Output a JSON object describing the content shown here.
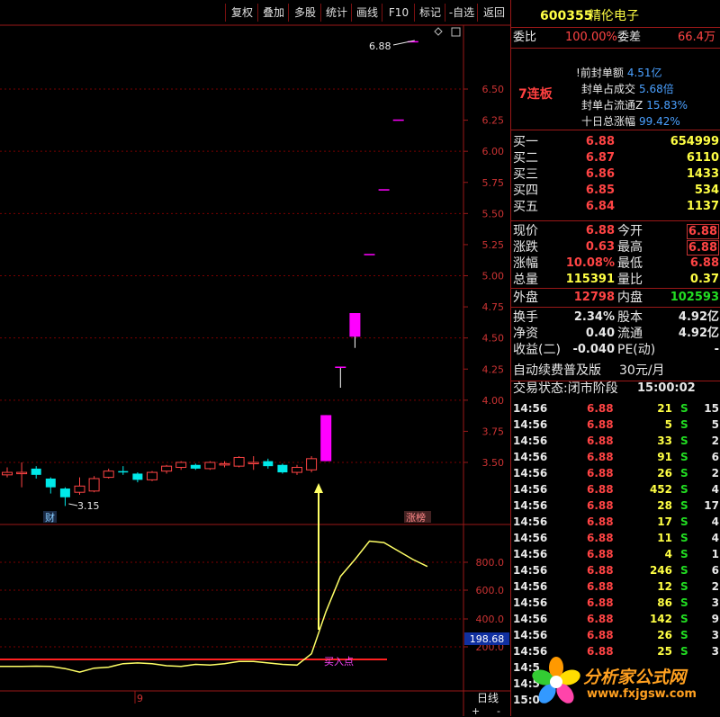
{
  "toolbar": {
    "buttons": [
      "复权",
      "叠加",
      "多股",
      "统计",
      "画线",
      "F10",
      "标记",
      "-自选",
      "返回"
    ]
  },
  "chart_data": {
    "type": "candlestick",
    "price_axis": {
      "ticks": [
        "6.50",
        "6.25",
        "6.00",
        "5.75",
        "5.50",
        "5.25",
        "5.00",
        "4.75",
        "4.50",
        "4.25",
        "4.00",
        "3.75",
        "3.50"
      ],
      "ylim": [
        3.25,
        6.95
      ]
    },
    "candles": [
      {
        "o": 3.4,
        "c": 3.42,
        "h": 3.46,
        "l": 3.38
      },
      {
        "o": 3.42,
        "c": 3.42,
        "h": 3.5,
        "l": 3.3
      },
      {
        "o": 3.45,
        "c": 3.4,
        "h": 3.47,
        "l": 3.37
      },
      {
        "o": 3.37,
        "c": 3.3,
        "h": 3.38,
        "l": 3.25
      },
      {
        "o": 3.29,
        "c": 3.22,
        "h": 3.3,
        "l": 3.15
      },
      {
        "o": 3.26,
        "c": 3.31,
        "h": 3.38,
        "l": 3.24
      },
      {
        "o": 3.27,
        "c": 3.37,
        "h": 3.39,
        "l": 3.26
      },
      {
        "o": 3.38,
        "c": 3.43,
        "h": 3.45,
        "l": 3.37
      },
      {
        "o": 3.43,
        "c": 3.42,
        "h": 3.47,
        "l": 3.4
      },
      {
        "o": 3.41,
        "c": 3.36,
        "h": 3.42,
        "l": 3.34
      },
      {
        "o": 3.36,
        "c": 3.42,
        "h": 3.43,
        "l": 3.35
      },
      {
        "o": 3.43,
        "c": 3.47,
        "h": 3.48,
        "l": 3.41
      },
      {
        "o": 3.46,
        "c": 3.5,
        "h": 3.51,
        "l": 3.44
      },
      {
        "o": 3.48,
        "c": 3.45,
        "h": 3.49,
        "l": 3.44
      },
      {
        "o": 3.45,
        "c": 3.5,
        "h": 3.51,
        "l": 3.44
      },
      {
        "o": 3.48,
        "c": 3.49,
        "h": 3.51,
        "l": 3.46
      },
      {
        "o": 3.47,
        "c": 3.54,
        "h": 3.55,
        "l": 3.46
      },
      {
        "o": 3.5,
        "c": 3.5,
        "h": 3.55,
        "l": 3.44
      },
      {
        "o": 3.51,
        "c": 3.47,
        "h": 3.53,
        "l": 3.45
      },
      {
        "o": 3.48,
        "c": 3.42,
        "h": 3.49,
        "l": 3.41
      },
      {
        "o": 3.42,
        "c": 3.46,
        "h": 3.48,
        "l": 3.4
      },
      {
        "o": 3.44,
        "c": 3.53,
        "h": 3.55,
        "l": 3.42
      },
      {
        "o": 3.51,
        "c": 3.88,
        "h": 3.88,
        "l": 3.51
      },
      {
        "o": 4.27,
        "c": 4.27,
        "h": 4.27,
        "l": 4.1
      },
      {
        "o": 4.51,
        "c": 4.7,
        "h": 4.7,
        "l": 4.42
      },
      {
        "o": 5.17,
        "c": 5.17,
        "h": 5.17,
        "l": 5.17
      },
      {
        "o": 5.69,
        "c": 5.69,
        "h": 5.69,
        "l": 5.69
      },
      {
        "o": 6.25,
        "c": 6.25,
        "h": 6.25,
        "l": 6.25
      },
      {
        "o": 6.88,
        "c": 6.88,
        "h": 6.88,
        "l": 6.88
      }
    ],
    "annotations": {
      "high_label": "6.88",
      "low_label": "3.15",
      "marker_cai": "财",
      "marker_zhangbang": "涨榜"
    },
    "indicator": {
      "axis_ticks": [
        "800.0",
        "600.0",
        "400.0",
        "200.0"
      ],
      "ylim": [
        0,
        1100
      ],
      "current_value": "198.68",
      "signal_label": "买入点",
      "line_level": 110,
      "values": [
        60,
        60,
        62,
        60,
        45,
        20,
        48,
        55,
        80,
        85,
        80,
        65,
        60,
        75,
        70,
        80,
        95,
        95,
        85,
        75,
        70,
        150,
        450,
        700,
        820,
        950,
        940,
        880,
        820
      ]
    },
    "bottom_axis_label": "9"
  },
  "quote": {
    "code": "600355",
    "name": "精伦电子",
    "weibi_label": "委比",
    "weibi_value": "100.00%",
    "weicha_label": "委差",
    "weicha_value": "66.4万",
    "lianban": "7连板",
    "seal_items": [
      {
        "label": "前封单额",
        "value": "4.51亿",
        "prefix": "!"
      },
      {
        "label": "封单占成交",
        "value": "5.68倍"
      },
      {
        "label": "封单占流通Z",
        "value": "15.83%"
      },
      {
        "label": "十日总涨幅",
        "value": "99.42%"
      }
    ],
    "bids": [
      {
        "label": "买一",
        "price": "6.88",
        "vol": "654999"
      },
      {
        "label": "买二",
        "price": "6.87",
        "vol": "6110"
      },
      {
        "label": "买三",
        "price": "6.86",
        "vol": "1433"
      },
      {
        "label": "买四",
        "price": "6.85",
        "vol": "534"
      },
      {
        "label": "买五",
        "price": "6.84",
        "vol": "1137"
      }
    ],
    "stats": {
      "xianjia_label": "现价",
      "xianjia": "6.88",
      "jinkai_label": "今开",
      "jinkai": "6.88",
      "zhangdie_label": "涨跌",
      "zhangdie": "0.63",
      "zuigao_label": "最高",
      "zuigao": "6.88",
      "zhangfu_label": "涨幅",
      "zhangfu": "10.08%",
      "zuidi_label": "最低",
      "zuidi": "6.88",
      "zongliang_label": "总量",
      "zongliang": "115391",
      "liangbi_label": "量比",
      "liangbi": "0.37",
      "waipan_label": "外盘",
      "waipan": "12798",
      "neipan_label": "内盘",
      "neipan": "102593",
      "huanshou_label": "换手",
      "huanshou": "2.34%",
      "guben_label": "股本",
      "guben": "4.92亿",
      "jingzi_label": "净资",
      "jingzi": "0.40",
      "liutong_label": "流通",
      "liutong": "4.92亿",
      "shouyi_label": "收益(二)",
      "shouyi": "-0.040",
      "pe_label": "PE(动)",
      "pe": "-"
    },
    "promo": {
      "text": "自动续费普及版",
      "price": "30元/月"
    },
    "status": {
      "label": "交易状态:闭市阶段",
      "time": "15:00:02"
    },
    "ticks": [
      {
        "t": "14:56",
        "p": "6.88",
        "v": "21",
        "s": "S",
        "n": "15"
      },
      {
        "t": "14:56",
        "p": "6.88",
        "v": "5",
        "s": "S",
        "n": "5"
      },
      {
        "t": "14:56",
        "p": "6.88",
        "v": "33",
        "s": "S",
        "n": "2"
      },
      {
        "t": "14:56",
        "p": "6.88",
        "v": "91",
        "s": "S",
        "n": "6"
      },
      {
        "t": "14:56",
        "p": "6.88",
        "v": "26",
        "s": "S",
        "n": "2"
      },
      {
        "t": "14:56",
        "p": "6.88",
        "v": "452",
        "s": "S",
        "n": "4"
      },
      {
        "t": "14:56",
        "p": "6.88",
        "v": "28",
        "s": "S",
        "n": "17"
      },
      {
        "t": "14:56",
        "p": "6.88",
        "v": "17",
        "s": "S",
        "n": "4"
      },
      {
        "t": "14:56",
        "p": "6.88",
        "v": "11",
        "s": "S",
        "n": "4"
      },
      {
        "t": "14:56",
        "p": "6.88",
        "v": "4",
        "s": "S",
        "n": "1"
      },
      {
        "t": "14:56",
        "p": "6.88",
        "v": "246",
        "s": "S",
        "n": "6"
      },
      {
        "t": "14:56",
        "p": "6.88",
        "v": "12",
        "s": "S",
        "n": "2"
      },
      {
        "t": "14:56",
        "p": "6.88",
        "v": "86",
        "s": "S",
        "n": "3"
      },
      {
        "t": "14:56",
        "p": "6.88",
        "v": "142",
        "s": "S",
        "n": "9"
      },
      {
        "t": "14:56",
        "p": "6.88",
        "v": "26",
        "s": "S",
        "n": "3"
      },
      {
        "t": "14:56",
        "p": "6.88",
        "v": "25",
        "s": "S",
        "n": "3"
      },
      {
        "t": "14:5",
        "p": "",
        "v": "",
        "s": "",
        "n": ""
      },
      {
        "t": "14:5",
        "p": "",
        "v": "",
        "s": "",
        "n": ""
      },
      {
        "t": "15:0",
        "p": "",
        "v": "",
        "s": "",
        "n": ""
      }
    ],
    "period_label": "日线",
    "zoom_plus": "+",
    "zoom_minus": "-"
  },
  "watermark": {
    "title": "分析家公式网",
    "url": "www.fxjgsw.com"
  },
  "colors": {
    "up": "#ff4444",
    "down": "#00ffff",
    "limit": "#ff00ff",
    "indicator": "#ffff66",
    "grid": "#8b0000",
    "signal_line": "#ff2020"
  }
}
